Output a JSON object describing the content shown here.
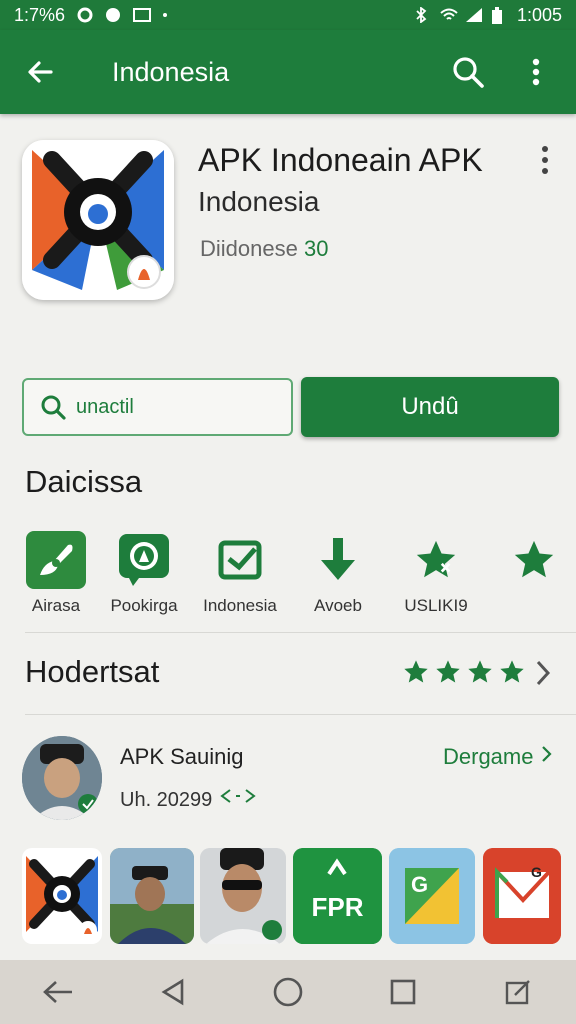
{
  "status_bar": {
    "time_left": "1:7%6",
    "time_right": "1:005"
  },
  "app_bar": {
    "title": "Indonesia"
  },
  "app": {
    "title": "APK Indoneain APK",
    "developer": "Indonesia",
    "meta_label": "Diidonese",
    "meta_value": "30"
  },
  "actions": {
    "secondary_label": "unactil",
    "primary_label": "Undû"
  },
  "categories_section": {
    "title": "Daicissa",
    "items": [
      {
        "label": "Airasa",
        "icon": "brush-icon"
      },
      {
        "label": "Pookirga",
        "icon": "compass-icon"
      },
      {
        "label": "Indonesia",
        "icon": "checkbox-icon"
      },
      {
        "label": "Avoeb",
        "icon": "download-arrow-icon"
      },
      {
        "label": "USLIKI9",
        "icon": "star-icon"
      },
      {
        "label": "",
        "icon": "star-icon"
      }
    ]
  },
  "ratings_section": {
    "title": "Hodertsat",
    "stars": 4
  },
  "review": {
    "name": "APK Sauinig",
    "meta": "Uh. 20299",
    "link": "Dergame"
  },
  "thumbnails": [
    {
      "icon": "app-logo-icon"
    },
    {
      "icon": "person-photo"
    },
    {
      "icon": "person-photo-sunglasses"
    },
    {
      "label": "FPR",
      "icon": "fpr-app-icon"
    },
    {
      "label": "G",
      "icon": "g-map-icon"
    },
    {
      "label": "G",
      "icon": "mail-app-icon"
    }
  ],
  "colors": {
    "primary": "#1e7d3c",
    "background": "#f1f1ee",
    "navbar": "#d9d5cf"
  }
}
